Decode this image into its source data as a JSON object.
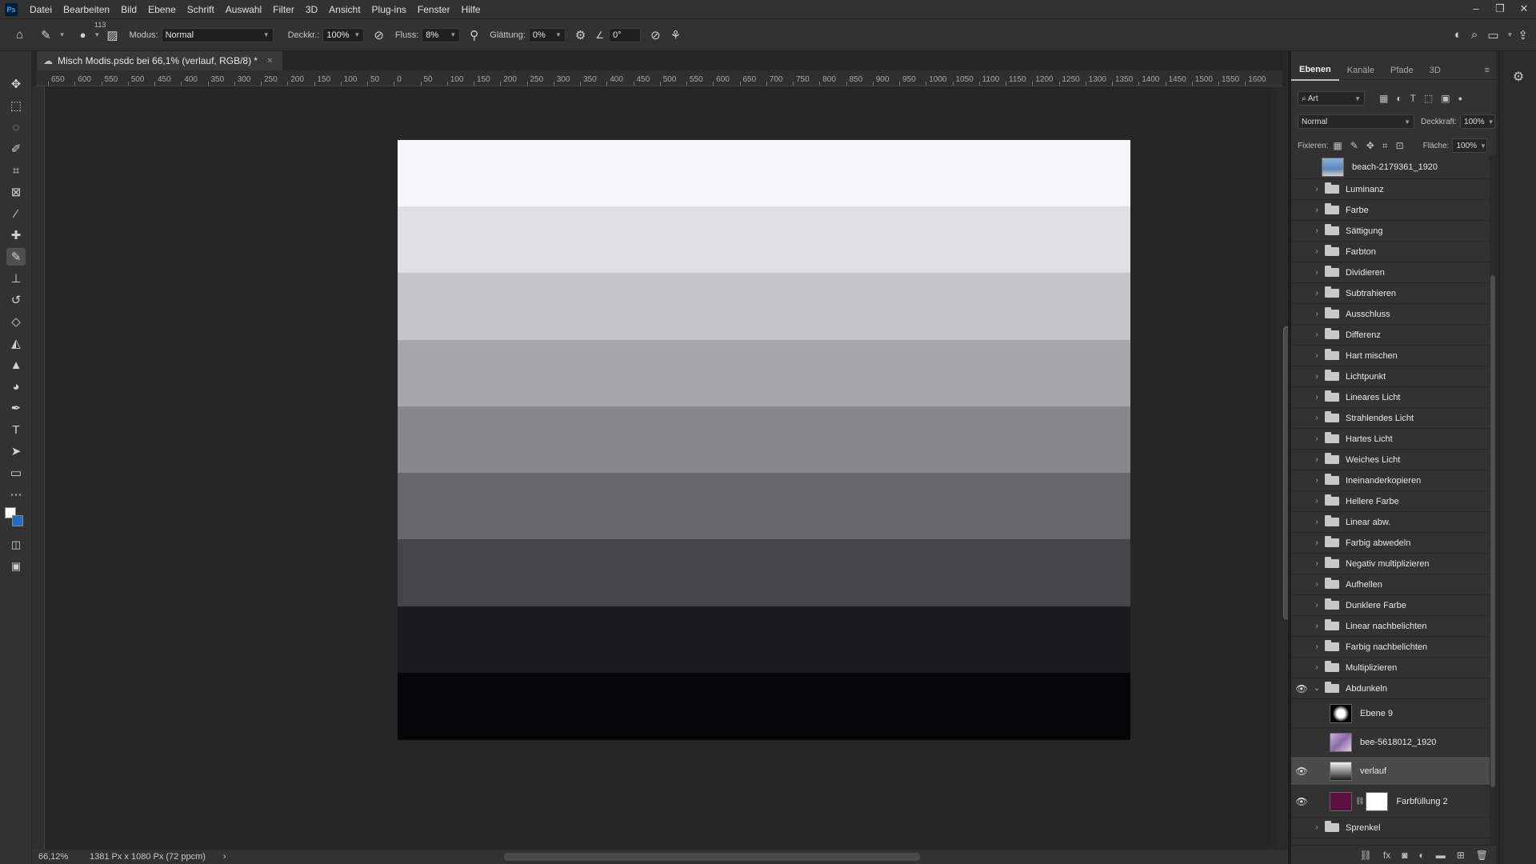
{
  "app": {
    "logo": "Ps"
  },
  "menu": [
    "Datei",
    "Bearbeiten",
    "Bild",
    "Ebene",
    "Schrift",
    "Auswahl",
    "Filter",
    "3D",
    "Ansicht",
    "Plug-ins",
    "Fenster",
    "Hilfe"
  ],
  "window_controls": {
    "minimize": "–",
    "restore": "❐",
    "close": "✕"
  },
  "options_bar": {
    "brush_size": "113",
    "modus_label": "Modus:",
    "modus_value": "Normal",
    "deckkraft_label": "Deckkr.:",
    "deckkraft_value": "100%",
    "fluss_label": "Fluss:",
    "fluss_value": "8%",
    "glaettung_label": "Glättung:",
    "glaettung_value": "0%",
    "angle_value": "0°"
  },
  "document": {
    "tab_title": "Misch Modis.psdc bei 66,1% (verlauf, RGB/8) *",
    "close": "×"
  },
  "ruler_h_labels": [
    "650",
    "600",
    "550",
    "500",
    "450",
    "400",
    "350",
    "300",
    "250",
    "200",
    "150",
    "100",
    "50",
    "0",
    "50",
    "100",
    "150",
    "200",
    "250",
    "300",
    "350",
    "400",
    "450",
    "500",
    "550",
    "600",
    "650",
    "700",
    "750",
    "800",
    "850",
    "900",
    "950",
    "1000",
    "1050",
    "1100",
    "1150",
    "1200",
    "1250",
    "1300",
    "1350",
    "1400",
    "1450",
    "1500",
    "1550",
    "1600"
  ],
  "canvas": {
    "bands": [
      "#f6f6f8",
      "#e0dfe2",
      "#c4c3c6",
      "#a7a6a9",
      "#88878a",
      "#68676a",
      "#454447",
      "#1c1b1e",
      "#060508"
    ]
  },
  "status": {
    "zoom": "66,12%",
    "dimensions": "1381 Px x 1080 Px (72 ppcm)",
    "arrow": "›"
  },
  "layers_panel": {
    "tabs": [
      "Ebenen",
      "Kanäle",
      "Pfade",
      "3D"
    ],
    "filter_label": "Art",
    "blend_mode": "Normal",
    "opacity_label": "Deckkraft:",
    "opacity_value": "100%",
    "lock_label": "Fixieren:",
    "fill_label": "Fläche:",
    "fill_value": "100%",
    "top_layer": "beach-2179361_1920",
    "groups": [
      "Luminanz",
      "Farbe",
      "Sättigung",
      "Farbton",
      "Dividieren",
      "Subtrahieren",
      "Ausschluss",
      "Differenz",
      "Hart mischen",
      "Lichtpunkt",
      "Lineares Licht",
      "Strahlendes Licht",
      "Hartes Licht",
      "Weiches Licht",
      "Ineinanderkopieren",
      "Hellere Farbe",
      "Linear abw.",
      "Farbig abwedeln",
      "Negativ multiplizieren",
      "Aufhellen",
      "Dunklere Farbe",
      "Linear nachbelichten",
      "Farbig nachbelichten",
      "Multiplizieren"
    ],
    "open_group": "Abdunkeln",
    "sublayers": [
      "Ebene 9",
      "bee-5618012_1920",
      "verlauf",
      "Farbfüllung 2"
    ],
    "last_group": "Sprenkel"
  }
}
